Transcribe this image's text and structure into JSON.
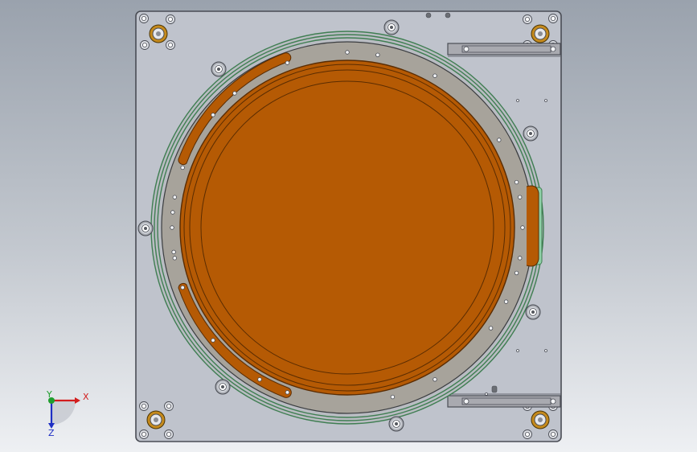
{
  "viewport": {
    "background_top": "#9aa2ad",
    "background_bottom": "#eef0f3"
  },
  "colors": {
    "plate": "#bfc3cc",
    "plate_edge": "#4a4d55",
    "ring": "#a7a39b",
    "ring_edge": "#3b3d40",
    "copper": "#b55a04",
    "copper_edge": "#5a2c02",
    "green_edge": "#3f7e52",
    "mint_insert": "#8fcfa6",
    "bracket": "#a9aab0"
  },
  "triad": {
    "x_label": "X",
    "y_label": "Y",
    "z_label": "Z",
    "x_color": "#d21d1d",
    "y_color": "#1f9e2e",
    "z_color": "#1e2fc4"
  }
}
